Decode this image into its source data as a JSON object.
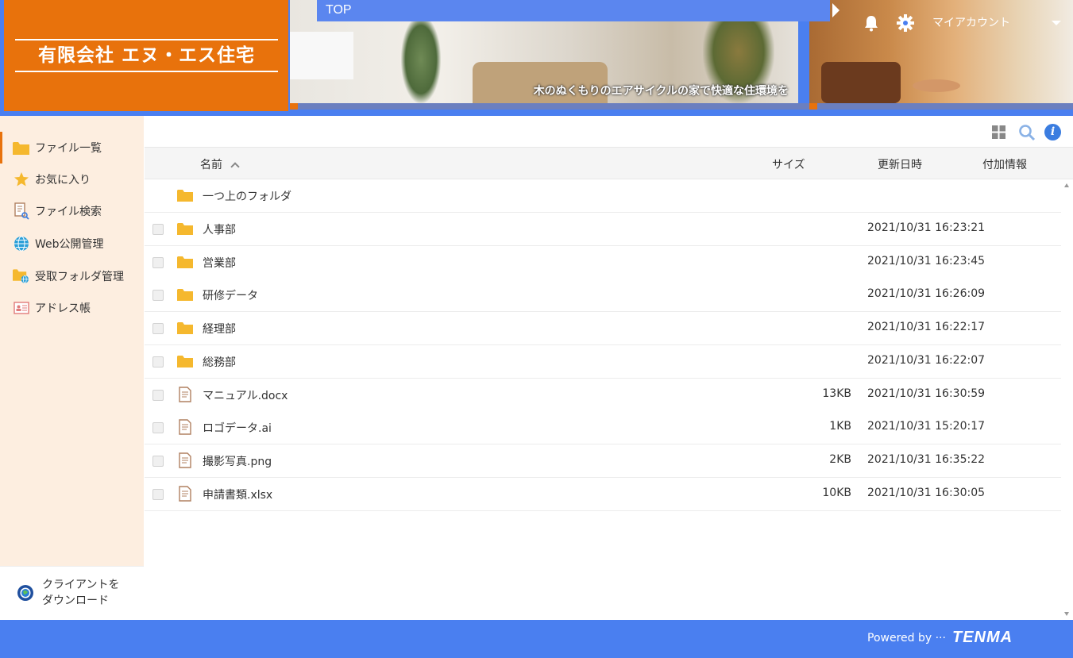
{
  "header": {
    "company_name": "有限会社 エヌ・エス住宅",
    "hero_caption": "木のぬくもりのエアサイクルの家で快適な住環境を",
    "breadcrumb": "TOP",
    "account_label": "マイアカウント",
    "brand_color": "#e8720c",
    "accent_color": "#4a7ff0"
  },
  "sidebar": {
    "items": [
      {
        "label": "ファイル一覧",
        "icon": "folder-icon",
        "active": true
      },
      {
        "label": "お気に入り",
        "icon": "star-icon",
        "active": false
      },
      {
        "label": "ファイル検索",
        "icon": "file-search-icon",
        "active": false
      },
      {
        "label": "Web公開管理",
        "icon": "globe-icon",
        "active": false
      },
      {
        "label": "受取フォルダ管理",
        "icon": "folder-globe-icon",
        "active": false
      },
      {
        "label": "アドレス帳",
        "icon": "address-card-icon",
        "active": false
      }
    ],
    "download_line1": "クライアントを",
    "download_line2": "ダウンロード"
  },
  "table": {
    "headers": {
      "name": "名前",
      "size": "サイズ",
      "updated": "更新日時",
      "extra": "付加情報"
    },
    "parent_folder": "一つ上のフォルダ",
    "rows": [
      {
        "type": "folder",
        "name": "人事部",
        "size": "",
        "updated": "2021/10/31 16:23:21"
      },
      {
        "type": "folder",
        "name": "営業部",
        "size": "",
        "updated": "2021/10/31 16:23:45"
      },
      {
        "type": "folder",
        "name": "研修データ",
        "size": "",
        "updated": "2021/10/31 16:26:09"
      },
      {
        "type": "folder",
        "name": "経理部",
        "size": "",
        "updated": "2021/10/31 16:22:17"
      },
      {
        "type": "folder",
        "name": "総務部",
        "size": "",
        "updated": "2021/10/31 16:22:07"
      },
      {
        "type": "file",
        "name": "マニュアル.docx",
        "size": "13KB",
        "updated": "2021/10/31 16:30:59"
      },
      {
        "type": "file",
        "name": "ロゴデータ.ai",
        "size": "1KB",
        "updated": "2021/10/31 15:20:17"
      },
      {
        "type": "file",
        "name": "撮影写真.png",
        "size": "2KB",
        "updated": "2021/10/31 16:35:22"
      },
      {
        "type": "file",
        "name": "申請書類.xlsx",
        "size": "10KB",
        "updated": "2021/10/31 16:30:05"
      }
    ]
  },
  "footer": {
    "powered_by": "Powered by ···",
    "brand": "TENMA"
  }
}
